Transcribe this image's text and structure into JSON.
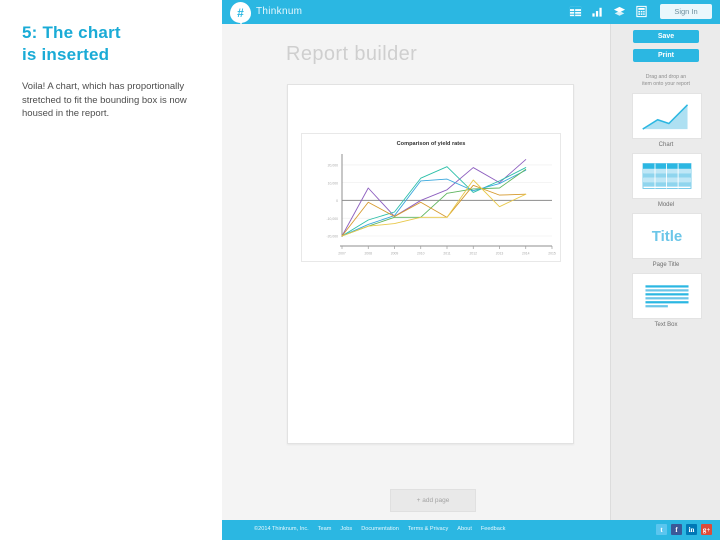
{
  "slide": {
    "title": "5: The chart\nis inserted",
    "title_line1": "5: The chart",
    "title_line2": "is inserted",
    "body": "Voila! A chart, which has proportionally stretched to fit the bounding box is now housed in the report.",
    "accent_color": "#1aabd6"
  },
  "header": {
    "brand": "Thinknum",
    "logo_glyph": "#",
    "signin_label": "Sign In",
    "icons": [
      "table-icon",
      "bar-chart-icon",
      "layers-icon",
      "calculator-icon"
    ]
  },
  "main": {
    "page_title": "Report builder",
    "add_page_label": "+ add page"
  },
  "tools": {
    "save_label": "Save",
    "print_label": "Print",
    "drag_hint_line1": "Drag and drop an",
    "drag_hint_line2": "item onto your report",
    "items": [
      {
        "label": "Chart",
        "icon": "area-chart-icon"
      },
      {
        "label": "Model",
        "icon": "table-grid-icon"
      },
      {
        "label": "Page Title",
        "icon": "title-text-icon",
        "glyph": "Title"
      },
      {
        "label": "Text Box",
        "icon": "text-lines-icon"
      }
    ]
  },
  "footer": {
    "copyright": "©2014 Thinknum, Inc.",
    "links": [
      "Team",
      "Jobs",
      "Documentation",
      "Terms & Privacy",
      "About",
      "Feedback"
    ],
    "socials": [
      {
        "name": "twitter",
        "glyph": "t",
        "color": "#5bc6ef"
      },
      {
        "name": "facebook",
        "glyph": "f",
        "color": "#3b5998"
      },
      {
        "name": "linkedin",
        "glyph": "in",
        "color": "#0077b5"
      },
      {
        "name": "googleplus",
        "glyph": "g+",
        "color": "#dd4b39"
      }
    ]
  },
  "chart_data": {
    "type": "line",
    "title": "Comparison of yield rates",
    "xlabel": "",
    "ylabel": "",
    "x": [
      "2007",
      "2008",
      "2009",
      "2010",
      "2011",
      "2012",
      "2013",
      "2014",
      "2015"
    ],
    "ylim": [
      -20000,
      25000
    ],
    "yticks": [
      20000,
      10000,
      0,
      -10000,
      -20000
    ],
    "yticklabels": [
      "20,000",
      "10,000",
      "0",
      "-10,000",
      "-20,000"
    ],
    "grid": true,
    "legend": "none",
    "zero_line": true,
    "series": [
      {
        "name": "series-purple",
        "color": "#8d5fbf",
        "values": [
          -20000,
          7000,
          -9000,
          0,
          6000,
          18500,
          10000,
          23000,
          null
        ]
      },
      {
        "name": "series-teal",
        "color": "#2bbfa8",
        "values": [
          -20000,
          -11000,
          -6500,
          12500,
          19000,
          4500,
          11000,
          18500,
          null
        ]
      },
      {
        "name": "series-cyan",
        "color": "#3aa8dd",
        "values": [
          -20000,
          -13500,
          -8500,
          11000,
          12000,
          5500,
          9500,
          17000,
          null
        ]
      },
      {
        "name": "series-green",
        "color": "#5fb55f",
        "values": [
          -20000,
          -14500,
          -9500,
          -9500,
          4000,
          6500,
          7000,
          17500,
          null
        ]
      },
      {
        "name": "series-gold",
        "color": "#d69a2e",
        "values": [
          -20000,
          -1000,
          -9000,
          -1000,
          -9500,
          8500,
          3000,
          3500,
          null
        ]
      },
      {
        "name": "series-yellow",
        "color": "#e8c84a",
        "values": [
          -20000,
          -14500,
          -13000,
          -9500,
          -9500,
          11500,
          -3500,
          3500,
          null
        ]
      }
    ]
  }
}
